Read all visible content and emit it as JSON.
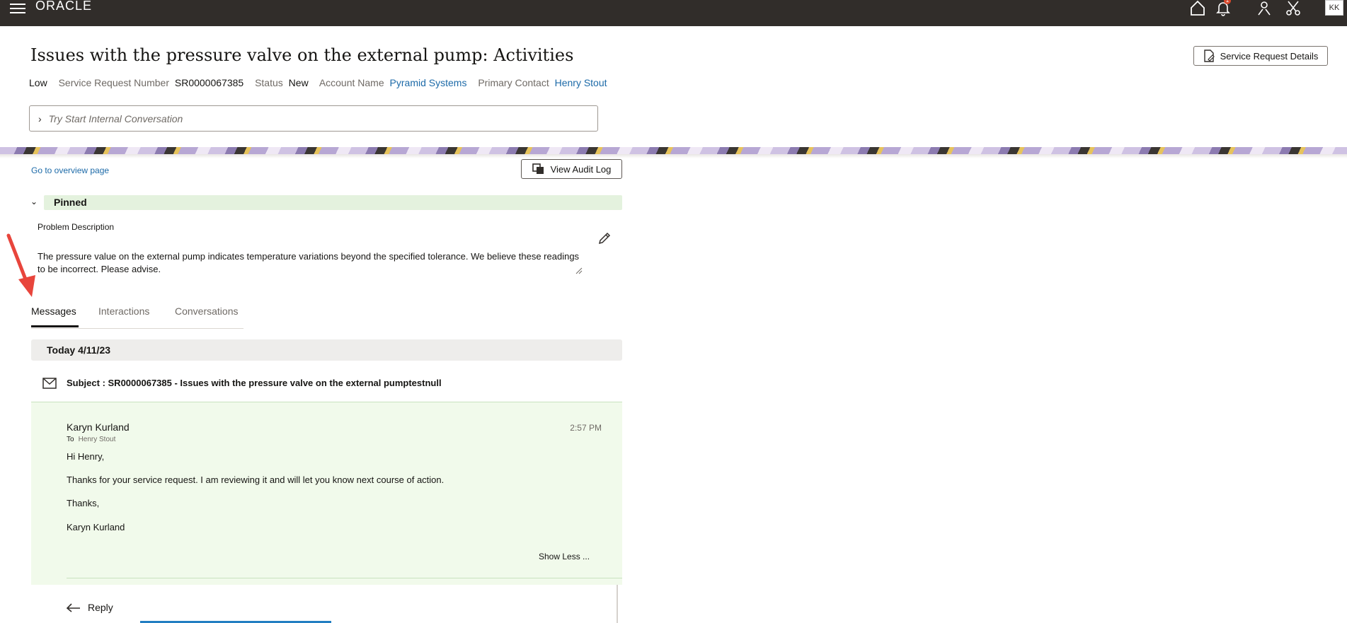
{
  "app": {
    "logo": "ORACLE",
    "avatar": "KK",
    "notification_count": "1"
  },
  "header": {
    "title": "Issues with the pressure valve on the external pump: Activities",
    "priority": "Low",
    "sr_label": "Service Request Number",
    "sr_number": "SR0000067385",
    "status_label": "Status",
    "status": "New",
    "account_label": "Account Name",
    "account": "Pyramid Systems",
    "contact_label": "Primary Contact",
    "contact": "Henry Stout",
    "details_button": "Service Request Details",
    "conversation_placeholder": "Try Start Internal Conversation"
  },
  "main": {
    "overview_link": "Go to overview page",
    "audit_button": "View Audit Log",
    "pinned_label": "Pinned",
    "problem_label": "Problem Description",
    "problem_text": "The pressure value on the external pump indicates temperature variations beyond the specified tolerance. We believe these readings to be incorrect. Please advise.",
    "tabs": [
      {
        "label": "Messages"
      },
      {
        "label": "Interactions"
      },
      {
        "label": "Conversations"
      }
    ],
    "date_header": "Today 4/11/23",
    "subject": "Subject : SR0000067385 - Issues with the pressure valve on the external pumptestnull",
    "message": {
      "sender": "Karyn Kurland",
      "time": "2:57 PM",
      "to_label": "To",
      "to": "Henry Stout",
      "greeting": "Hi Henry,",
      "body": "Thanks for your service request. I am reviewing it and will let you know next course of action.",
      "closing": "Thanks,",
      "signature": "Karyn Kurland",
      "show_less": "Show Less ..."
    },
    "reply_label": "Reply"
  },
  "colors": {
    "topbar": "#312d2a",
    "link": "#1c6aa8",
    "pinned_bg": "#e4f2de",
    "message_bg": "#f1faeb",
    "annotation_arrow": "#e8453c"
  }
}
